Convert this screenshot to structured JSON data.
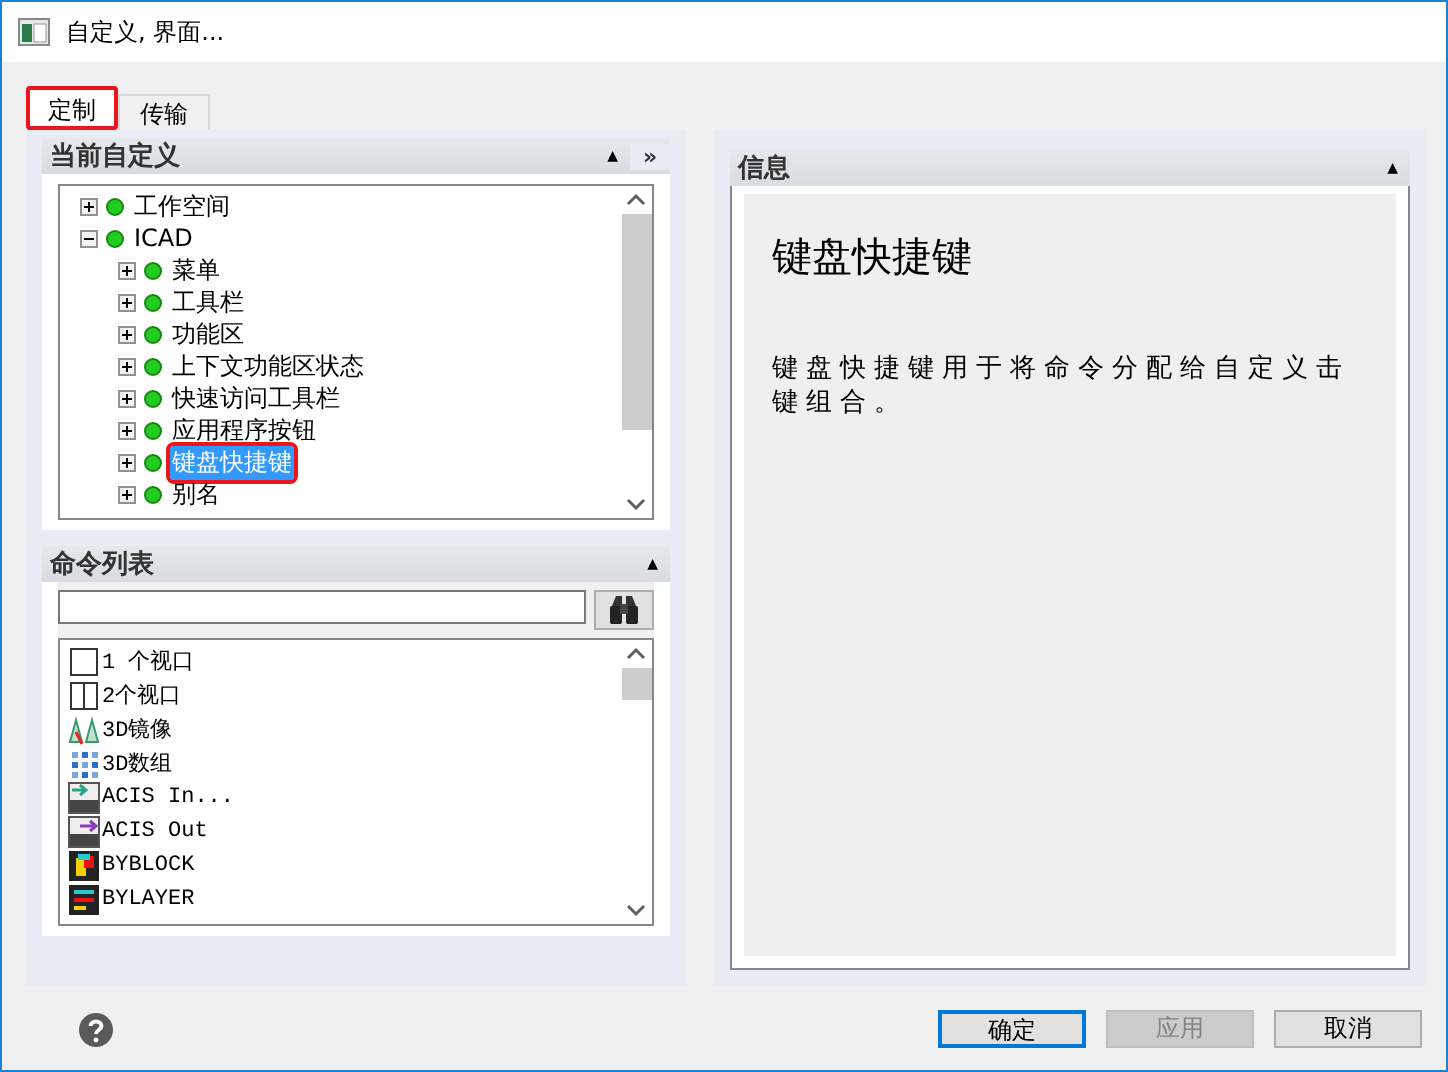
{
  "window": {
    "title": "自定义, 界面..."
  },
  "tabs": [
    {
      "label": "定制",
      "selected": true,
      "highlighted": true
    },
    {
      "label": "传输",
      "selected": false,
      "highlighted": false
    }
  ],
  "current_customization": {
    "title": "当前自定义",
    "collapse": "▲",
    "more": "»",
    "tree": [
      {
        "label": "工作空间",
        "expanded": false,
        "selected": false,
        "highlighted": false
      },
      {
        "label": "ICAD",
        "expanded": true,
        "selected": false,
        "highlighted": false,
        "children": [
          {
            "label": "菜单",
            "expanded": false,
            "selected": false,
            "highlighted": false
          },
          {
            "label": "工具栏",
            "expanded": false,
            "selected": false,
            "highlighted": false
          },
          {
            "label": "功能区",
            "expanded": false,
            "selected": false,
            "highlighted": false
          },
          {
            "label": "上下文功能区状态",
            "expanded": false,
            "selected": false,
            "highlighted": false
          },
          {
            "label": "快速访问工具栏",
            "expanded": false,
            "selected": false,
            "highlighted": false
          },
          {
            "label": "应用程序按钮",
            "expanded": false,
            "selected": false,
            "highlighted": false
          },
          {
            "label": "键盘快捷键",
            "expanded": false,
            "selected": true,
            "highlighted": true
          },
          {
            "label": "别名",
            "expanded": false,
            "selected": false,
            "highlighted": false
          }
        ]
      }
    ]
  },
  "command_list": {
    "title": "命令列表",
    "collapse": "▲",
    "items": [
      {
        "label": "1 个视口",
        "kind": "viewport1"
      },
      {
        "label": "2个视口",
        "kind": "viewport2"
      },
      {
        "label": "3D镜像",
        "kind": "mirror"
      },
      {
        "label": "3D数组",
        "kind": "array"
      },
      {
        "label": "ACIS In...",
        "kind": "acis-in"
      },
      {
        "label": "ACIS Out",
        "kind": "acis-out"
      },
      {
        "label": "BYBLOCK",
        "kind": "byblock"
      },
      {
        "label": "BYLAYER",
        "kind": "bylayer"
      }
    ]
  },
  "info": {
    "title": "信息",
    "collapse": "▲",
    "heading": "键盘快捷键",
    "description": "键盘快捷键用于将命令分配给自定义击键组合。"
  },
  "buttons": [
    {
      "label": "确定",
      "disabled": false,
      "default": true
    },
    {
      "label": "应用",
      "disabled": true,
      "default": false
    },
    {
      "label": "取消",
      "disabled": false,
      "default": false
    }
  ]
}
